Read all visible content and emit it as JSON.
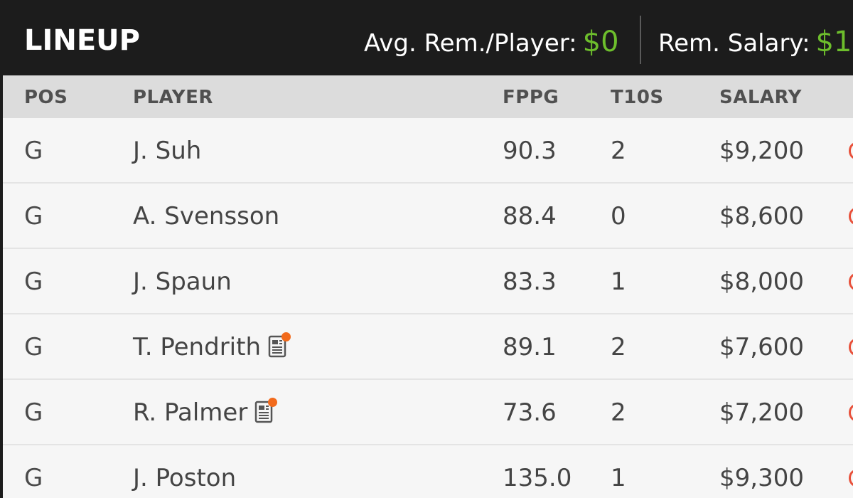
{
  "header": {
    "title": "LINEUP",
    "avg_label": "Avg. Rem./Player:",
    "avg_value": "$0",
    "rem_label": "Rem. Salary:",
    "rem_value": "$1"
  },
  "columns": {
    "pos": "POS",
    "player": "PLAYER",
    "fppg": "FPPG",
    "t10s": "T10S",
    "salary": "SALARY"
  },
  "rows": [
    {
      "pos": "G",
      "player": "J. Suh",
      "fppg": "90.3",
      "t10s": "2",
      "salary": "$9,200",
      "news": false
    },
    {
      "pos": "G",
      "player": "A. Svensson",
      "fppg": "88.4",
      "t10s": "0",
      "salary": "$8,600",
      "news": false
    },
    {
      "pos": "G",
      "player": "J. Spaun",
      "fppg": "83.3",
      "t10s": "1",
      "salary": "$8,000",
      "news": false
    },
    {
      "pos": "G",
      "player": "T. Pendrith",
      "fppg": "89.1",
      "t10s": "2",
      "salary": "$7,600",
      "news": true
    },
    {
      "pos": "G",
      "player": "R. Palmer",
      "fppg": "73.6",
      "t10s": "2",
      "salary": "$7,200",
      "news": true
    },
    {
      "pos": "G",
      "player": "J. Poston",
      "fppg": "135.0",
      "t10s": "1",
      "salary": "$9,300",
      "news": false
    }
  ],
  "colors": {
    "header_bg": "#1c1c1c",
    "accent_green": "#6dbe2c",
    "news_dot": "#f26a1b",
    "remove_icon": "#e8503a"
  },
  "icons": {
    "news": "player-news-icon",
    "remove": "remove-player-icon"
  }
}
